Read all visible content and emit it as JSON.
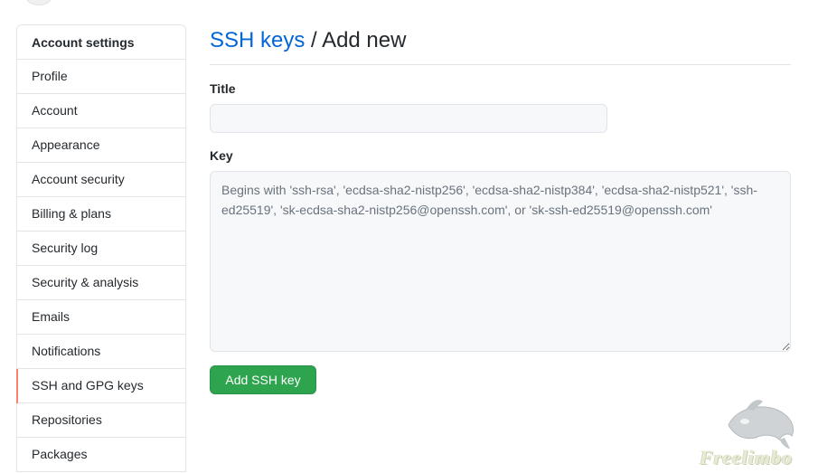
{
  "sidebar": {
    "header": "Account settings",
    "items": [
      {
        "label": "Profile"
      },
      {
        "label": "Account"
      },
      {
        "label": "Appearance"
      },
      {
        "label": "Account security"
      },
      {
        "label": "Billing & plans"
      },
      {
        "label": "Security log"
      },
      {
        "label": "Security & analysis"
      },
      {
        "label": "Emails"
      },
      {
        "label": "Notifications"
      },
      {
        "label": "SSH and GPG keys",
        "selected": true
      },
      {
        "label": "Repositories"
      },
      {
        "label": "Packages"
      }
    ],
    "selected_accent": "#f9826c"
  },
  "main": {
    "breadcrumb": {
      "link": "SSH keys",
      "separator": " / ",
      "current": "Add new"
    },
    "title_field": {
      "label": "Title",
      "value": "",
      "placeholder": ""
    },
    "key_field": {
      "label": "Key",
      "value": "",
      "placeholder": "Begins with 'ssh-rsa', 'ecdsa-sha2-nistp256', 'ecdsa-sha2-nistp384', 'ecdsa-sha2-nistp521', 'ssh-ed25519', 'sk-ecdsa-sha2-nistp256@openssh.com', or 'sk-ssh-ed25519@openssh.com'"
    },
    "submit_label": "Add SSH key"
  },
  "colors": {
    "link": "#0366d6",
    "primary_button": "#2ea44f",
    "border": "#e1e4e8",
    "input_background": "#f6f8fa"
  },
  "watermark": {
    "text": "Freelimbo",
    "icon": "orca-whale-icon"
  }
}
